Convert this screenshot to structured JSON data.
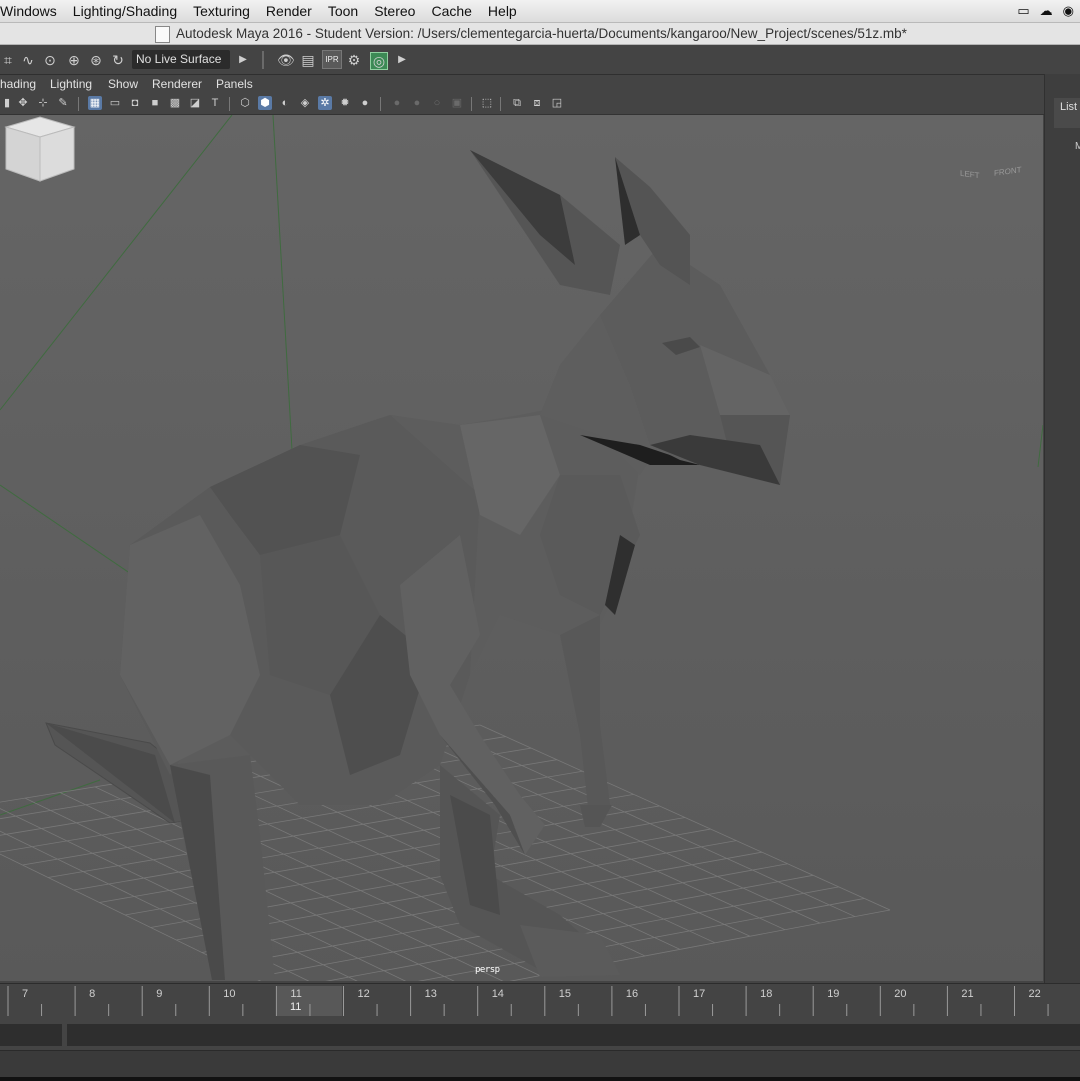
{
  "menubar": {
    "items": [
      "Windows",
      "Lighting/Shading",
      "Texturing",
      "Render",
      "Toon",
      "Stereo",
      "Cache",
      "Help"
    ]
  },
  "titlebar": {
    "title": "Autodesk Maya 2016 - Student Version: /Users/clementegarcia-huerta/Documents/kangaroo/New_Project/scenes/51z.mb*"
  },
  "statusline": {
    "live_surface": "No Live Surface",
    "ipr_label": "IPR"
  },
  "panel_menu": {
    "items": [
      "hading",
      "Lighting",
      "Show",
      "Renderer",
      "Panels"
    ]
  },
  "side_panel": {
    "tab_label": "List",
    "sub_label": "M"
  },
  "viewport": {
    "camera_label": "persp",
    "viewcube": {
      "left": "LEFT",
      "front": "FRONT"
    },
    "colors": {
      "model": "#5a5a5a",
      "grid": "#767676",
      "bg": "#606060"
    }
  },
  "timeline": {
    "ticks": [
      "7",
      "8",
      "9",
      "10",
      "11",
      "12",
      "13",
      "14",
      "15",
      "16",
      "17",
      "18",
      "19",
      "20",
      "21",
      "22"
    ],
    "current_frame": "11"
  }
}
